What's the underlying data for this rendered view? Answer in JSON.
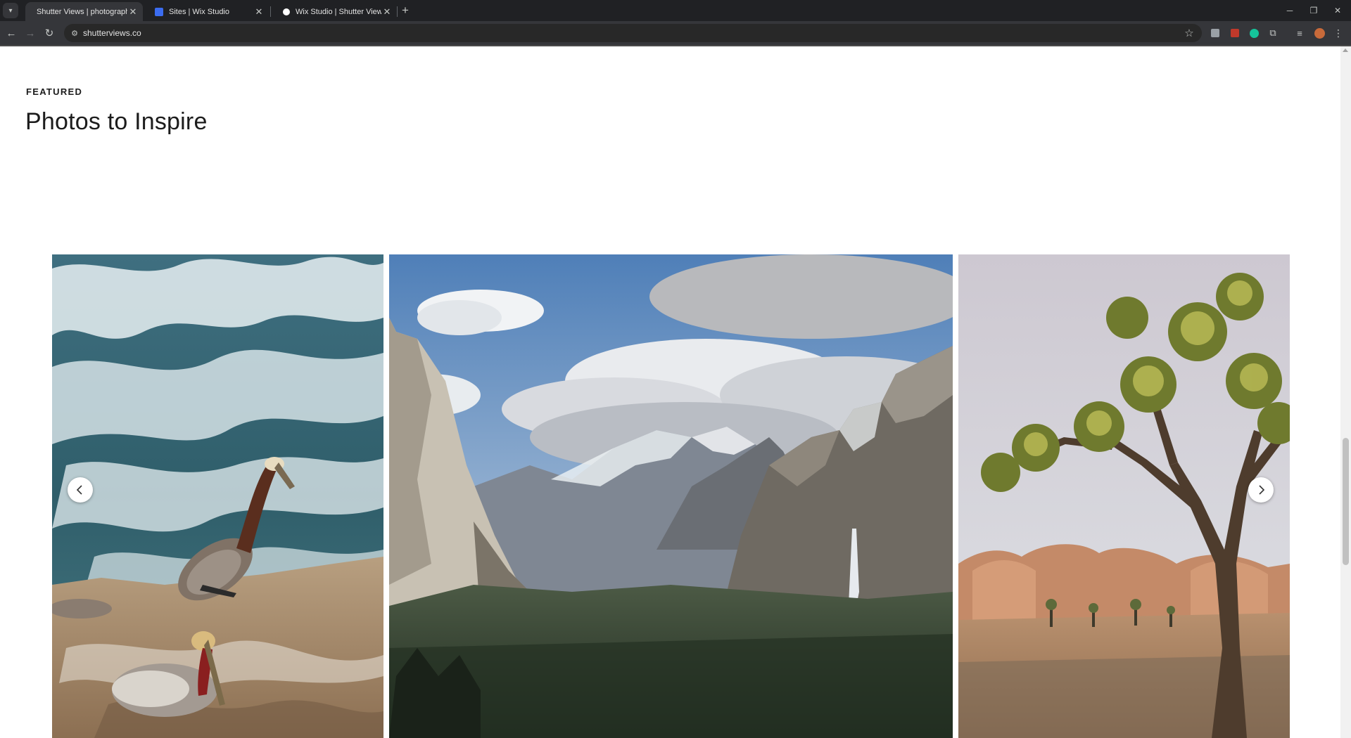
{
  "browser": {
    "tabs": [
      {
        "title": "Shutter Views | photography b",
        "active": true
      },
      {
        "title": "Sites | Wix Studio",
        "active": false
      },
      {
        "title": "Wix Studio | Shutter Views",
        "active": false
      }
    ],
    "address": "shutterviews.co",
    "icons": {
      "tab_search": "chevron-down-icon",
      "back": "arrow-left-icon",
      "forward": "arrow-right-icon",
      "reload": "reload-icon",
      "site_info": "tune-icon",
      "bookmark": "star-icon",
      "new_tab": "plus-icon",
      "minimize": "minimize-icon",
      "restore": "restore-icon",
      "close_window": "close-icon"
    }
  },
  "section": {
    "eyebrow": "FEATURED",
    "title": "Photos to Inspire"
  },
  "gallery": {
    "photos": [
      {
        "subject": "pelicans-on-coastal-rock-photo"
      },
      {
        "subject": "yosemite-valley-photo"
      },
      {
        "subject": "joshua-tree-desert-photo"
      }
    ],
    "prev_icon": "chevron-left-icon",
    "next_icon": "chevron-right-icon"
  },
  "colors": {
    "tabstrip": "#202124",
    "toolbar": "#35363a",
    "page_bg": "#ffffff",
    "heading": "#1c1c1c"
  }
}
